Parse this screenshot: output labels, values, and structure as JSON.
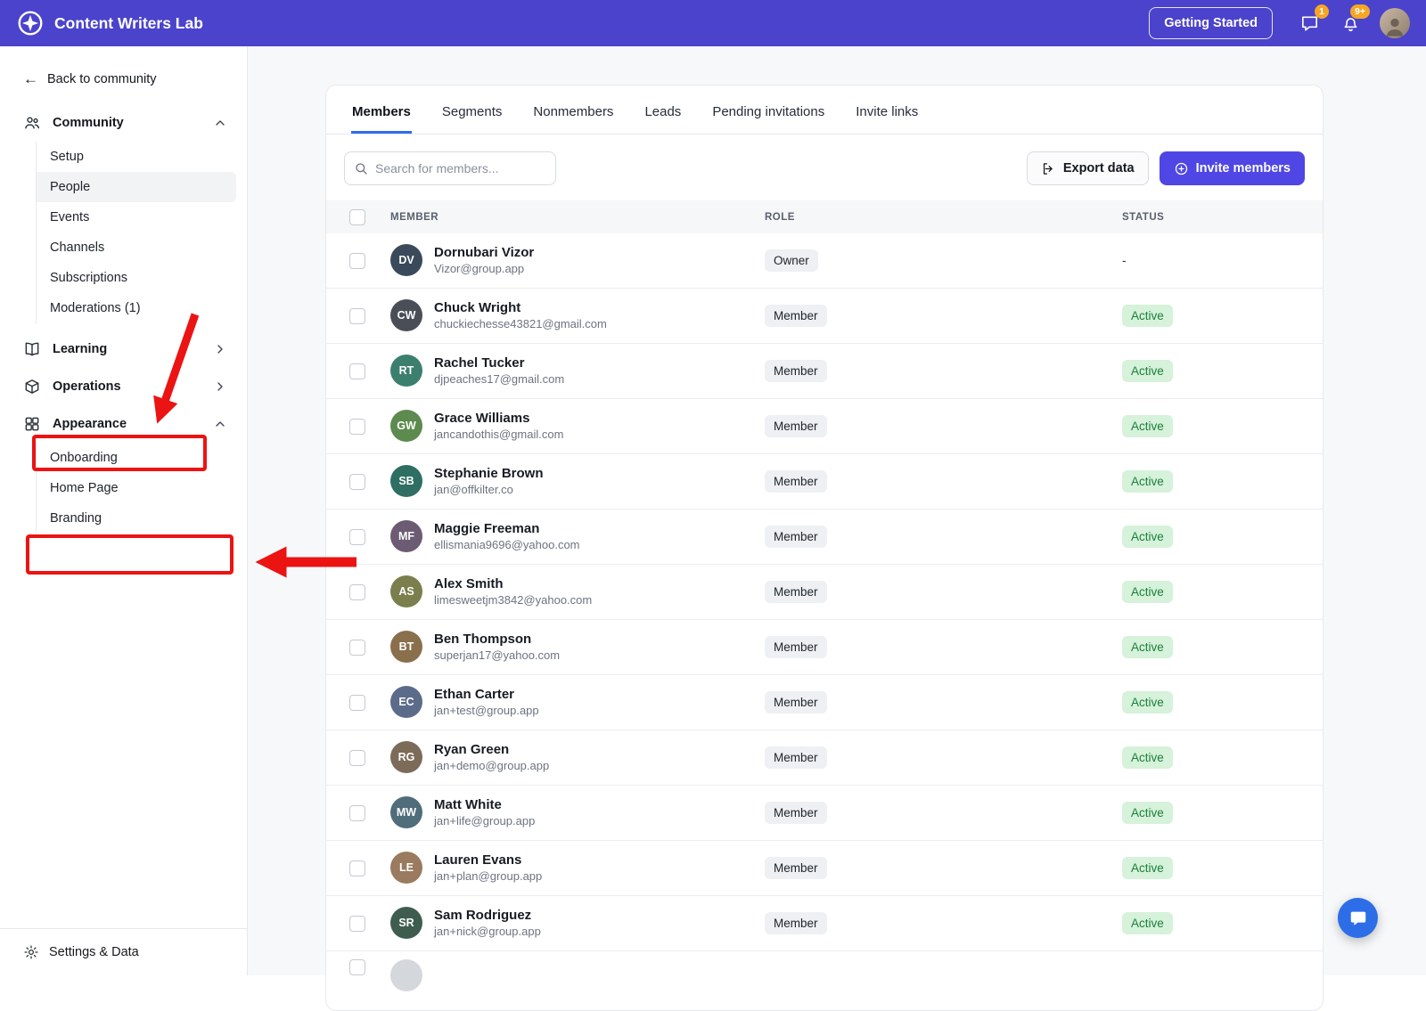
{
  "colors": {
    "topbar": "#4b43cb",
    "primary": "#4f46e5",
    "tab-underline": "#2f6bed",
    "status-active-bg": "#d6f2da",
    "status-active-text": "#1b7f3b",
    "role-badge-bg": "#eef0f3",
    "badge-orange": "#f6a623",
    "annotation": "#ec1313",
    "chat-launcher": "#2d6ee8"
  },
  "topbar": {
    "brand": "Content Writers Lab",
    "getting_started_label": "Getting Started",
    "messages_badge": "1",
    "notifications_badge": "9+"
  },
  "sidebar": {
    "back_label": "Back to community",
    "groups": [
      {
        "label": "Community",
        "icon": "community-icon",
        "expanded": true,
        "items": [
          {
            "label": "Setup"
          },
          {
            "label": "People",
            "active": true
          },
          {
            "label": "Events"
          },
          {
            "label": "Channels"
          },
          {
            "label": "Subscriptions"
          },
          {
            "label": "Moderations  (1)"
          }
        ]
      },
      {
        "label": "Learning",
        "icon": "learning-icon",
        "expanded": false,
        "items": []
      },
      {
        "label": "Operations",
        "icon": "operations-icon",
        "expanded": false,
        "items": []
      },
      {
        "label": "Appearance",
        "icon": "appearance-icon",
        "expanded": true,
        "items": [
          {
            "label": "Onboarding"
          },
          {
            "label": "Home Page"
          },
          {
            "label": "Branding"
          }
        ]
      }
    ],
    "footer_label": "Settings & Data"
  },
  "tabs": [
    {
      "label": "Members",
      "active": true
    },
    {
      "label": "Segments"
    },
    {
      "label": "Nonmembers"
    },
    {
      "label": "Leads"
    },
    {
      "label": "Pending invitations"
    },
    {
      "label": "Invite links"
    }
  ],
  "search": {
    "placeholder": "Search for members..."
  },
  "buttons": {
    "export": "Export data",
    "invite": "Invite members"
  },
  "members": {
    "columns": [
      "MEMBER",
      "ROLE",
      "STATUS"
    ],
    "rows": [
      {
        "name": "Dornubari Vizor",
        "email": "Vizor@group.app",
        "role": "Owner",
        "status": "-",
        "avatar_color": "#3b4a5a"
      },
      {
        "name": "Chuck Wright",
        "email": "chuckiechesse43821@gmail.com",
        "role": "Member",
        "status": "Active",
        "avatar_color": "#4a4f57"
      },
      {
        "name": "Rachel Tucker",
        "email": "djpeaches17@gmail.com",
        "role": "Member",
        "status": "Active",
        "avatar_color": "#3d7f6e"
      },
      {
        "name": "Grace Williams",
        "email": "jancandothis@gmail.com",
        "role": "Member",
        "status": "Active",
        "avatar_color": "#5d8a4e"
      },
      {
        "name": "Stephanie Brown",
        "email": "jan@offkilter.co",
        "role": "Member",
        "status": "Active",
        "avatar_color": "#2e6e63"
      },
      {
        "name": "Maggie Freeman",
        "email": "ellismania9696@yahoo.com",
        "role": "Member",
        "status": "Active",
        "avatar_color": "#6b5b73"
      },
      {
        "name": "Alex Smith",
        "email": "limesweetjm3842@yahoo.com",
        "role": "Member",
        "status": "Active",
        "avatar_color": "#7a7f4d"
      },
      {
        "name": "Ben Thompson",
        "email": "superjan17@yahoo.com",
        "role": "Member",
        "status": "Active",
        "avatar_color": "#8a6f4d"
      },
      {
        "name": "Ethan Carter",
        "email": "jan+test@group.app",
        "role": "Member",
        "status": "Active",
        "avatar_color": "#5b6b8a"
      },
      {
        "name": "Ryan Green",
        "email": "jan+demo@group.app",
        "role": "Member",
        "status": "Active",
        "avatar_color": "#7d6b5a"
      },
      {
        "name": "Matt White",
        "email": "jan+life@group.app",
        "role": "Member",
        "status": "Active",
        "avatar_color": "#4f6d7a"
      },
      {
        "name": "Lauren Evans",
        "email": "jan+plan@group.app",
        "role": "Member",
        "status": "Active",
        "avatar_color": "#9a7b5f"
      },
      {
        "name": "Sam Rodriguez",
        "email": "jan+nick@group.app",
        "role": "Member",
        "status": "Active",
        "avatar_color": "#3f5d4e"
      }
    ]
  }
}
